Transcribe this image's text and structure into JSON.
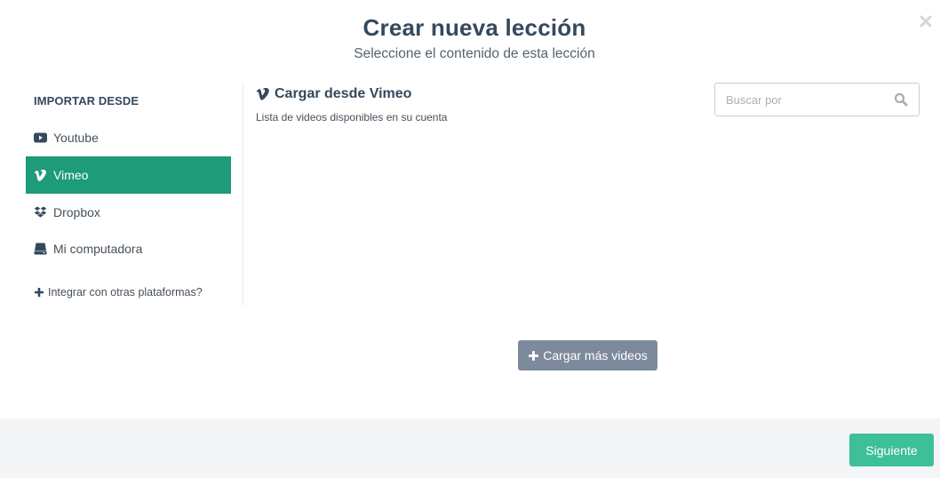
{
  "modal": {
    "title": "Crear nueva lección",
    "subtitle": "Seleccione el contenido de esta lección",
    "close_icon": "close-icon"
  },
  "sidebar": {
    "heading": "IMPORTAR DESDE",
    "items": [
      {
        "label": "Youtube",
        "icon": "youtube-icon",
        "active": false
      },
      {
        "label": "Vimeo",
        "icon": "vimeo-icon",
        "active": true
      },
      {
        "label": "Dropbox",
        "icon": "dropbox-icon",
        "active": false
      },
      {
        "label": "Mi computadora",
        "icon": "hard-drive-icon",
        "active": false
      }
    ],
    "integrate_link": "Integrar con otras plataformas?"
  },
  "content": {
    "title": "Cargar desde Vimeo",
    "subtitle": "Lista de videos disponibles en su cuenta",
    "search": {
      "placeholder": "Buscar por",
      "value": ""
    },
    "load_more_label": "Cargar más videos"
  },
  "footer": {
    "next_label": "Siguiente"
  },
  "colors": {
    "accent_active": "#1e9b78",
    "primary_button": "#3dbf98",
    "secondary_button": "#7d8a9c",
    "heading_text": "#34495e"
  }
}
